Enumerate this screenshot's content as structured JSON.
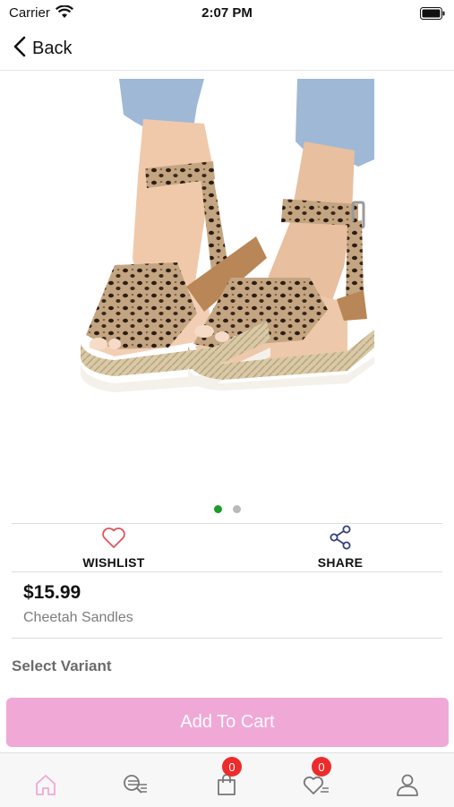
{
  "status_bar": {
    "carrier": "Carrier",
    "time": "2:07 PM"
  },
  "nav": {
    "back_label": "Back"
  },
  "product": {
    "image_icon": "leopard-print-sandals-image",
    "carousel": {
      "count": 2,
      "active_index": 0
    },
    "price": "$15.99",
    "name": "Cheetah Sandles"
  },
  "actions": {
    "wishlist_label": "WISHLIST",
    "share_label": "SHARE"
  },
  "variant": {
    "title": "Select Variant"
  },
  "cart": {
    "button_label": "Add To Cart"
  },
  "tab_bar": {
    "items": [
      {
        "icon": "home-icon",
        "active": true
      },
      {
        "icon": "search-list-icon"
      },
      {
        "icon": "shopping-bag-icon",
        "badge": "0"
      },
      {
        "icon": "wishlist-heart-icon",
        "badge": "0"
      },
      {
        "icon": "profile-icon"
      }
    ]
  },
  "colors": {
    "accent_pink": "#f0a8d7",
    "wishlist_red": "#e0535b",
    "share_blue": "#33407a",
    "badge_red": "#ee2b2b",
    "dot_active": "#1e9b29"
  }
}
